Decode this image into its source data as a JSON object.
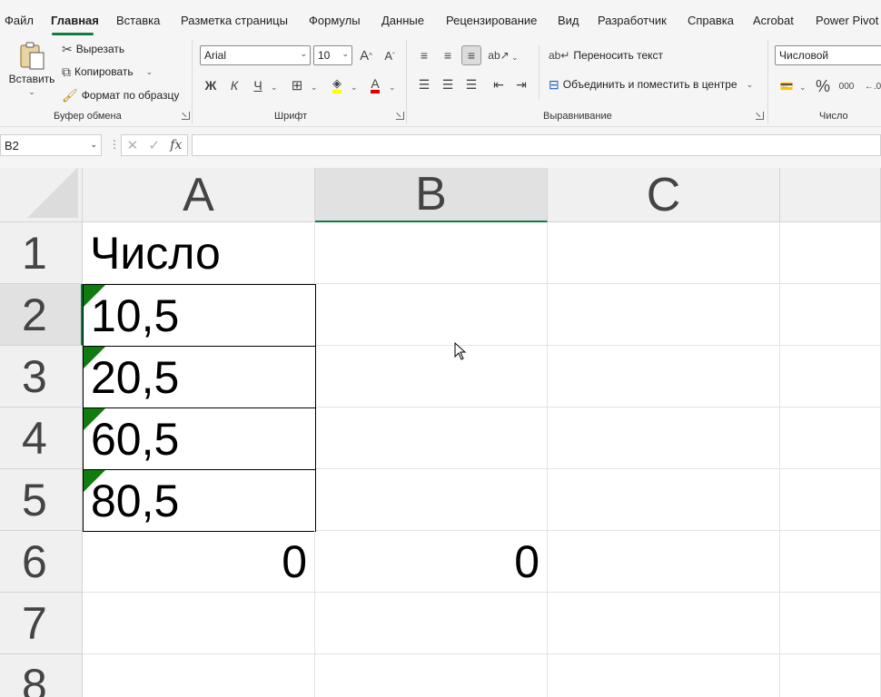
{
  "menu": {
    "items": [
      {
        "label": "Файл"
      },
      {
        "label": "Главная",
        "active": true
      },
      {
        "label": "Вставка"
      },
      {
        "label": "Разметка страницы"
      },
      {
        "label": "Формулы"
      },
      {
        "label": "Данные"
      },
      {
        "label": "Рецензирование"
      },
      {
        "label": "Вид"
      },
      {
        "label": "Разработчик"
      },
      {
        "label": "Справка"
      },
      {
        "label": "Acrobat"
      },
      {
        "label": "Power Pivot"
      }
    ]
  },
  "ribbon": {
    "clipboard": {
      "paste": "Вставить",
      "cut": "Вырезать",
      "copy": "Копировать",
      "format_painter": "Формат по образцу",
      "label": "Буфер обмена"
    },
    "font": {
      "name": "Arial",
      "size": "10",
      "bold": "Ж",
      "italic": "К",
      "underline": "Ч",
      "grow": "A",
      "shrink": "A",
      "font_color_letter": "A",
      "label": "Шрифт"
    },
    "alignment": {
      "wrap_text": "Переносить текст",
      "merge_center": "Объединить и поместить в центре",
      "label": "Выравнивание"
    },
    "number": {
      "format": "Числовой",
      "percent": "%",
      "thousands": "000",
      "label": "Число"
    }
  },
  "formula_bar": {
    "name_box": "B2",
    "formula": ""
  },
  "sheet": {
    "columns": [
      "A",
      "B",
      "C"
    ],
    "rows": [
      "1",
      "2",
      "3",
      "4",
      "5",
      "6",
      "7",
      "8"
    ],
    "cells": {
      "A1": "Число",
      "A2": "10,5",
      "A3": "20,5",
      "A4": "60,5",
      "A5": "80,5",
      "A6": "0",
      "B6": "0"
    }
  },
  "colors": {
    "accent": "#107c41",
    "error_indicator": "#107c10"
  }
}
